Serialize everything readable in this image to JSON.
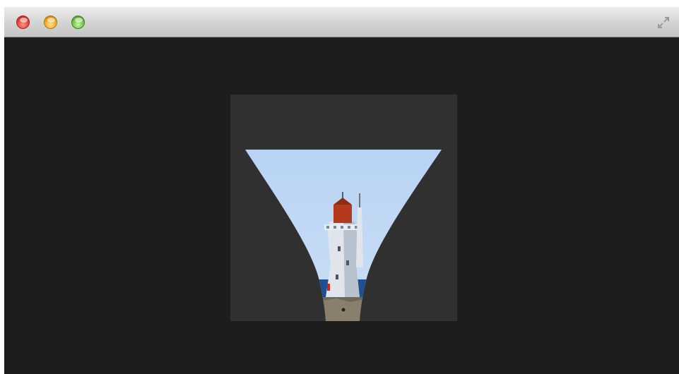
{
  "window": {
    "title": "",
    "controls": {
      "close": "close-button",
      "minimize": "minimize-button",
      "zoom": "zoom-button",
      "fullscreen_icon": "fullscreen-arrows-icon"
    }
  },
  "content": {
    "image_subject": "lighthouse",
    "effect": "genie-minimize-warp"
  },
  "colors": {
    "background": "#1d1d1d",
    "stage": "#303030",
    "sky": "#a9c8ef",
    "lighthouse_lamp": "#b33a1d",
    "tower": "#dfe5ea"
  }
}
